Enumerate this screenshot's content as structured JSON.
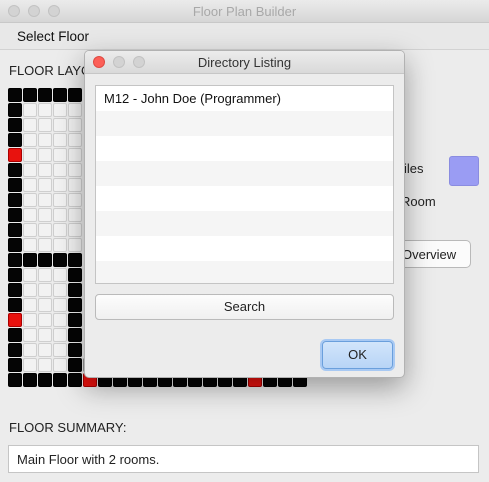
{
  "window": {
    "title": "Floor Plan Builder"
  },
  "menu": {
    "select_floor": "Select Floor"
  },
  "floor_layout_label": "FLOOR LAYOUT",
  "floor_summary_label": "FLOOR SUMMARY:",
  "floor_summary_value": "Main Floor with 2 rooms.",
  "background": {
    "files_fragment": "iles",
    "room_fragment": "Room",
    "overview_fragment": "Overview",
    "swatch_color": "#9a9cf3"
  },
  "grid": {
    "rows": [
      "BBBBB",
      "BWWWW",
      "BWWWW",
      "BWWWW",
      "RWWWW",
      "BWWWW",
      "BWWWW",
      "BWWWW",
      "BWWWW",
      "BWWWW",
      "BWWWW",
      "BBBBB",
      "BWWWB",
      "BWWWB",
      "BWWWB",
      "RWWWB",
      "BWWWB",
      "BWWWB",
      "BWWWBGGGGGBGGBNNNNNB",
      "BBBBBRBBBBBBBBBBRBBB"
    ],
    "colors": {
      "B": "#050505",
      "W": "#f2f2f2",
      "G": "#b3b3b3",
      "R": "#e8120e",
      "N": "#1b1fb4"
    }
  },
  "dialog": {
    "title": "Directory Listing",
    "items": [
      "M12 - John Doe (Programmer)",
      "",
      "",
      "",
      "",
      "",
      "",
      ""
    ],
    "search_label": "Search",
    "ok_label": "OK"
  }
}
